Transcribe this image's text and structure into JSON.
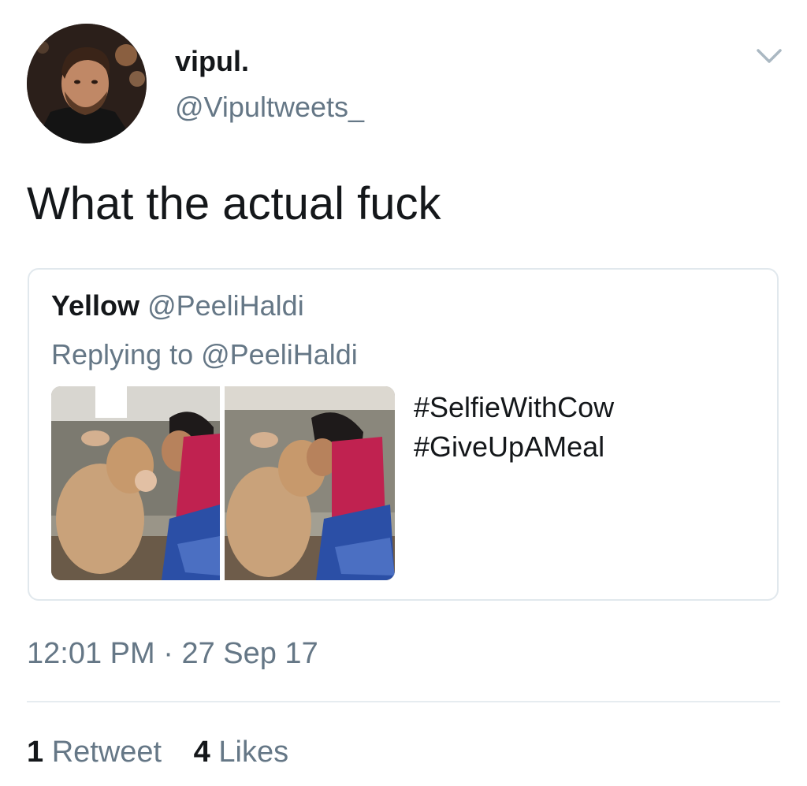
{
  "author": {
    "display_name": "vipul.",
    "handle": "@Vipultweets_"
  },
  "tweet": {
    "text": "What the actual fuck"
  },
  "quoted_tweet": {
    "display_name": "Yellow",
    "handle": "@PeeliHaldi",
    "reply_prefix": "Replying to",
    "reply_to": "@PeeliHaldi",
    "lines": [
      "#SelfieWithCow",
      "#GiveUpAMeal"
    ]
  },
  "meta": {
    "time": "12:01 PM",
    "separator": "·",
    "date": "27 Sep 17"
  },
  "stats": {
    "retweets_count": "1",
    "retweets_label": "Retweet",
    "likes_count": "4",
    "likes_label": "Likes"
  },
  "icons": {
    "menu": "chevron-down-icon"
  },
  "colors": {
    "text_primary": "#14171a",
    "text_secondary": "#657786",
    "border": "#e1e8ed"
  }
}
